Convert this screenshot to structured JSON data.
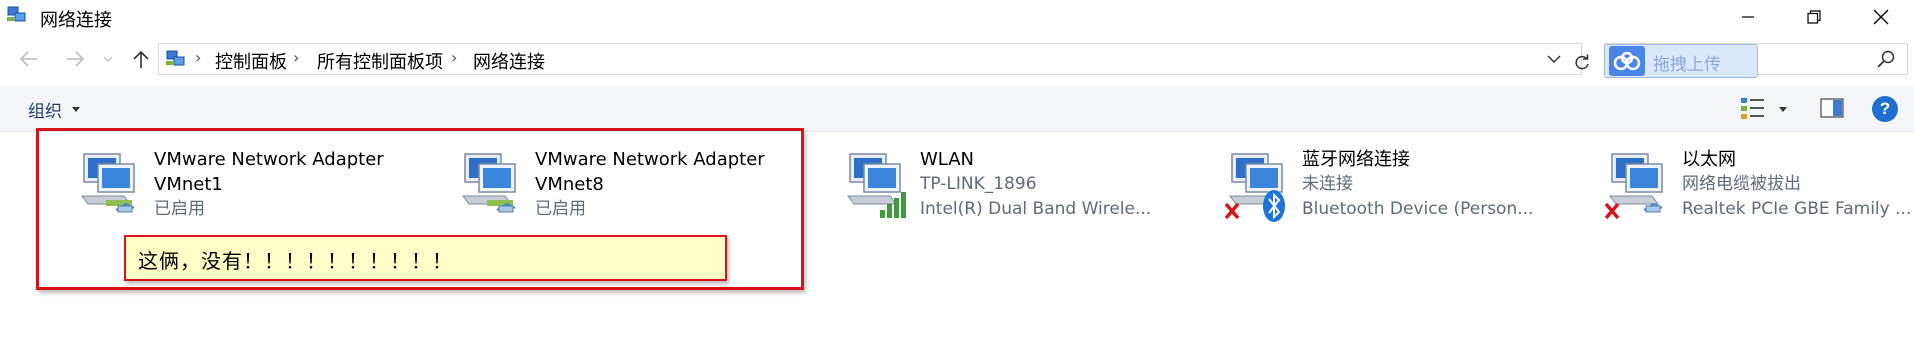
{
  "window": {
    "title": "网络连接",
    "title_icon": "network-connections-icon",
    "controls": [
      "minimize-icon",
      "restore-icon",
      "close-icon"
    ]
  },
  "addressbar": {
    "breadcrumbs": [
      "控制面板",
      "所有控制面板项",
      "网络连接"
    ],
    "nav_icons": [
      "back-arrow-icon",
      "forward-arrow-icon",
      "recent-dropdown-icon",
      "up-arrow-icon"
    ]
  },
  "baidu_button": {
    "label": "拖拽上传",
    "icon": "baidu-cloud-icon"
  },
  "search": {
    "placeholder": "",
    "icon": "search-icon"
  },
  "command_bar": {
    "organize_label": "组织",
    "view_icon": "change-view-icon",
    "preview_icon": "preview-pane-icon",
    "help_label": "?"
  },
  "adapters": [
    {
      "name": "VMware Network Adapter\nVMnet1",
      "status": "已启用",
      "device": "",
      "icon": "network-adapter-icon"
    },
    {
      "name": "VMware Network Adapter\nVMnet8",
      "status": "已启用",
      "device": "",
      "icon": "network-adapter-icon"
    },
    {
      "name": "WLAN",
      "status": "TP-LINK_1896",
      "device": "Intel(R) Dual Band Wirele...",
      "icon": "wifi-signal-icon"
    },
    {
      "name": "蓝牙网络连接",
      "status": "未连接",
      "device": "Bluetooth Device (Person...",
      "icon": "bluetooth-icon"
    },
    {
      "name": "以太网",
      "status": "网络电缆被拔出",
      "device": "Realtek PCIe GBE Family ...",
      "icon": "disconnected-x-icon"
    }
  ],
  "annotation": {
    "note": "这俩，没有！！！！！！！！！！"
  },
  "colors": {
    "command_bar_bg": "#f4f6f9",
    "annotation_red": "#d8131c",
    "note_bg": "#ffffc8",
    "status_text": "#5f6b78",
    "help_blue": "#1f6fd1"
  }
}
